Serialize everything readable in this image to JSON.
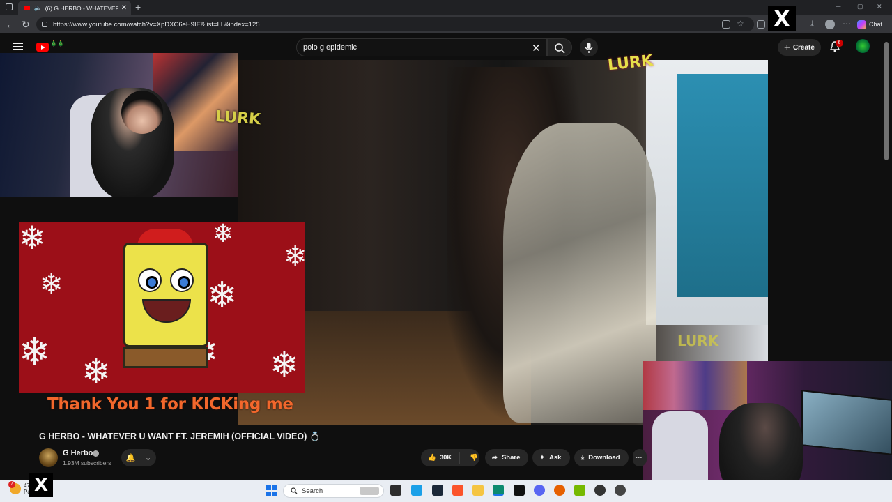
{
  "browser": {
    "tab_title": "(6) G HERBO - WHATEVER U",
    "tab_close": "✕",
    "new_tab": "+",
    "url": "https://www.youtube.com/watch?v=XpDXC6eH9IE&list=LL&index=125",
    "chat_label": "Chat"
  },
  "masthead": {
    "search_value": "polo g epidemic",
    "create_label": "Create",
    "notification_count": "6"
  },
  "overlay": {
    "lurk_text": "LURK",
    "gif_caption": "Thank You 1 for KICKing me",
    "x_logo": "X"
  },
  "video": {
    "title": "G HERBO - WHATEVER U WANT FT. JEREMIH (OFFICIAL VIDEO)",
    "title_emoji": "💍",
    "channel_name": "G Herbo",
    "subscribers": "1.93M subscribers",
    "likes": "30K",
    "share_label": "Share",
    "ask_label": "Ask",
    "download_label": "Download",
    "more_label": "⋯"
  },
  "taskbar": {
    "weather_temp": "47",
    "weather_sub": "Pa",
    "weather_badge": "7",
    "search_placeholder": "Search"
  },
  "colors": {
    "youtube_red": "#ff0000",
    "caption_orange": "#f2672c",
    "lurk_yellow": "#e6e04a",
    "gif_background": "#9c0f18"
  }
}
